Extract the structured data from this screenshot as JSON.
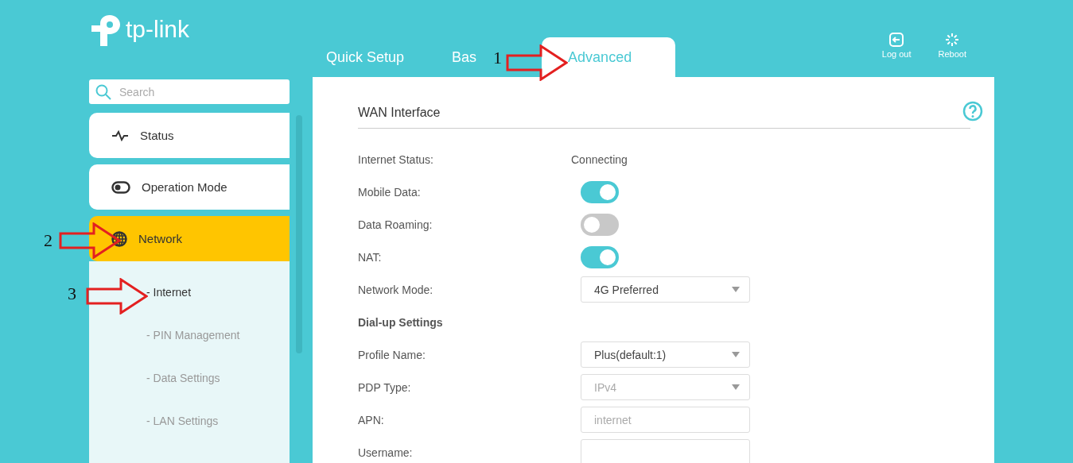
{
  "header": {
    "logo": "tp-link",
    "tabs": [
      {
        "label": "Quick Setup",
        "selected": false
      },
      {
        "label": "Bas",
        "selected": false
      },
      {
        "label": "Advanced",
        "selected": true
      }
    ],
    "actions": [
      {
        "kind": "logout",
        "label": "Log out"
      },
      {
        "kind": "reboot",
        "label": "Reboot"
      }
    ]
  },
  "sidebar": {
    "search": {
      "placeholder": "Search"
    },
    "items": [
      {
        "kind": "status",
        "label": "Status",
        "selected": false
      },
      {
        "kind": "mode",
        "label": "Operation Mode",
        "selected": false
      },
      {
        "kind": "network",
        "label": "Network",
        "selected": true,
        "children": [
          {
            "label": "- Internet",
            "selected": true
          },
          {
            "label": "- PIN Management",
            "selected": false
          },
          {
            "label": "- Data Settings",
            "selected": false
          },
          {
            "label": "- LAN Settings",
            "selected": false
          }
        ]
      }
    ]
  },
  "panel": {
    "title": "WAN Interface",
    "rows": [
      {
        "kind": "text",
        "label": "Internet Status:",
        "value": "Connecting"
      },
      {
        "kind": "toggle",
        "label": "Mobile Data:",
        "on": true
      },
      {
        "kind": "toggle",
        "label": "Data Roaming:",
        "on": false
      },
      {
        "kind": "toggle",
        "label": "NAT:",
        "on": true
      },
      {
        "kind": "select",
        "label": "Network Mode:",
        "value": "4G Preferred",
        "disabled": false
      },
      {
        "kind": "heading",
        "label": "Dial-up Settings"
      },
      {
        "kind": "select",
        "label": "Profile Name:",
        "value": "Plus(default:1)",
        "disabled": false
      },
      {
        "kind": "select",
        "label": "PDP Type:",
        "value": "IPv4",
        "disabled": true
      },
      {
        "kind": "input",
        "label": "APN:",
        "placeholder": "internet"
      },
      {
        "kind": "input",
        "label": "Username:"
      }
    ]
  },
  "annotations": [
    "1",
    "2",
    "3"
  ]
}
